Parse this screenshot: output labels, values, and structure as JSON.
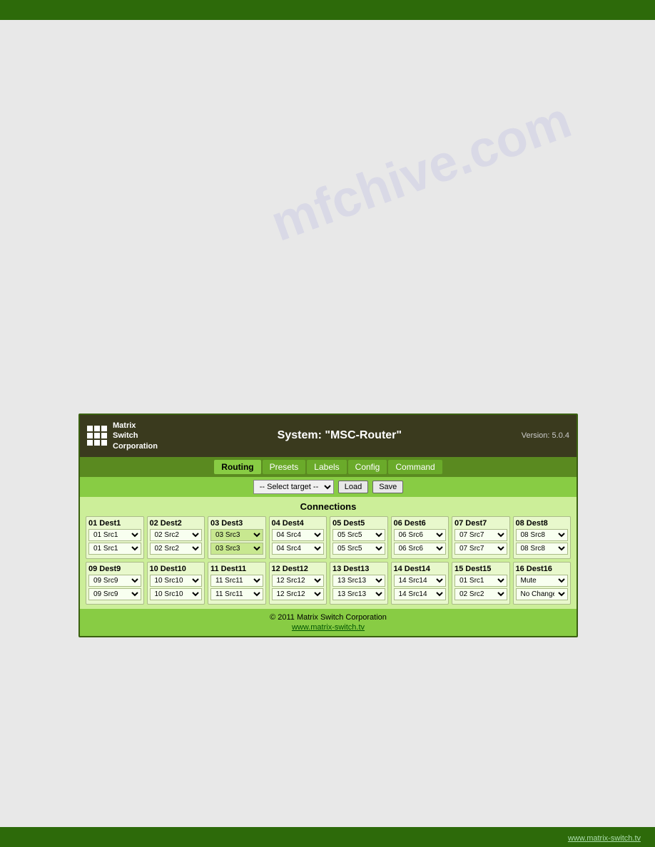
{
  "topBar": {},
  "bottomBar": {
    "link": "www.matrix-switch.tv"
  },
  "watermark": "mfchive.com",
  "app": {
    "logoLines": [
      "Matrix",
      "Switch",
      "Corporation"
    ],
    "systemTitle": "System: \"MSC-Router\"",
    "version": "Version: 5.0.4",
    "nav": {
      "tabs": [
        {
          "label": "Routing",
          "id": "routing",
          "active": true
        },
        {
          "label": "Presets",
          "id": "presets",
          "active": false
        },
        {
          "label": "Labels",
          "id": "labels",
          "active": false
        },
        {
          "label": "Config",
          "id": "config",
          "active": false
        },
        {
          "label": "Command",
          "id": "command",
          "active": false
        }
      ]
    },
    "toolbar": {
      "selectLabel": "-- Select target --",
      "loadBtn": "Load",
      "saveBtn": "Save"
    },
    "connections": {
      "title": "Connections",
      "destinations": [
        {
          "label": "01 Dest1",
          "src1": "01 Src1",
          "src2": "01 Src1",
          "highlighted": false
        },
        {
          "label": "02 Dest2",
          "src1": "02 Src2",
          "src2": "02 Src2",
          "highlighted": false
        },
        {
          "label": "03 Dest3",
          "src1": "03 Src3",
          "src2": "03 Src3",
          "highlighted": true
        },
        {
          "label": "04 Dest4",
          "src1": "04 Src4",
          "src2": "04 Src4",
          "highlighted": false
        },
        {
          "label": "05 Dest5",
          "src1": "05 Src5",
          "src2": "05 Src5",
          "highlighted": false
        },
        {
          "label": "06 Dest6",
          "src1": "06 Src6",
          "src2": "06 Src6",
          "highlighted": false
        },
        {
          "label": "07 Dest7",
          "src1": "07 Src7",
          "src2": "07 Src7",
          "highlighted": false
        },
        {
          "label": "08 Dest8",
          "src1": "08 Src8",
          "src2": "08 Src8",
          "highlighted": false
        },
        {
          "label": "09 Dest9",
          "src1": "09 Src9",
          "src2": "09 Src9",
          "highlighted": false
        },
        {
          "label": "10 Dest10",
          "src1": "10 Src10",
          "src2": "10 Src10",
          "highlighted": false
        },
        {
          "label": "11 Dest11",
          "src1": "11 Src11",
          "src2": "11 Src11",
          "highlighted": false
        },
        {
          "label": "12 Dest12",
          "src1": "12 Src12",
          "src2": "12 Src12",
          "highlighted": false
        },
        {
          "label": "13 Dest13",
          "src1": "13 Src13",
          "src2": "13 Src13",
          "highlighted": false
        },
        {
          "label": "14 Dest14",
          "src1": "14 Src14",
          "src2": "14 Src14",
          "highlighted": false
        },
        {
          "label": "15 Dest15",
          "src1": "01 Src1",
          "src2": "02 Src2",
          "highlighted": false
        },
        {
          "label": "16 Dest16",
          "src1": "Mute",
          "src2": "No Change",
          "highlighted": false
        }
      ]
    },
    "footer": {
      "copyright": "© 2011 Matrix Switch Corporation",
      "link": "www.matrix-switch.tv"
    }
  }
}
